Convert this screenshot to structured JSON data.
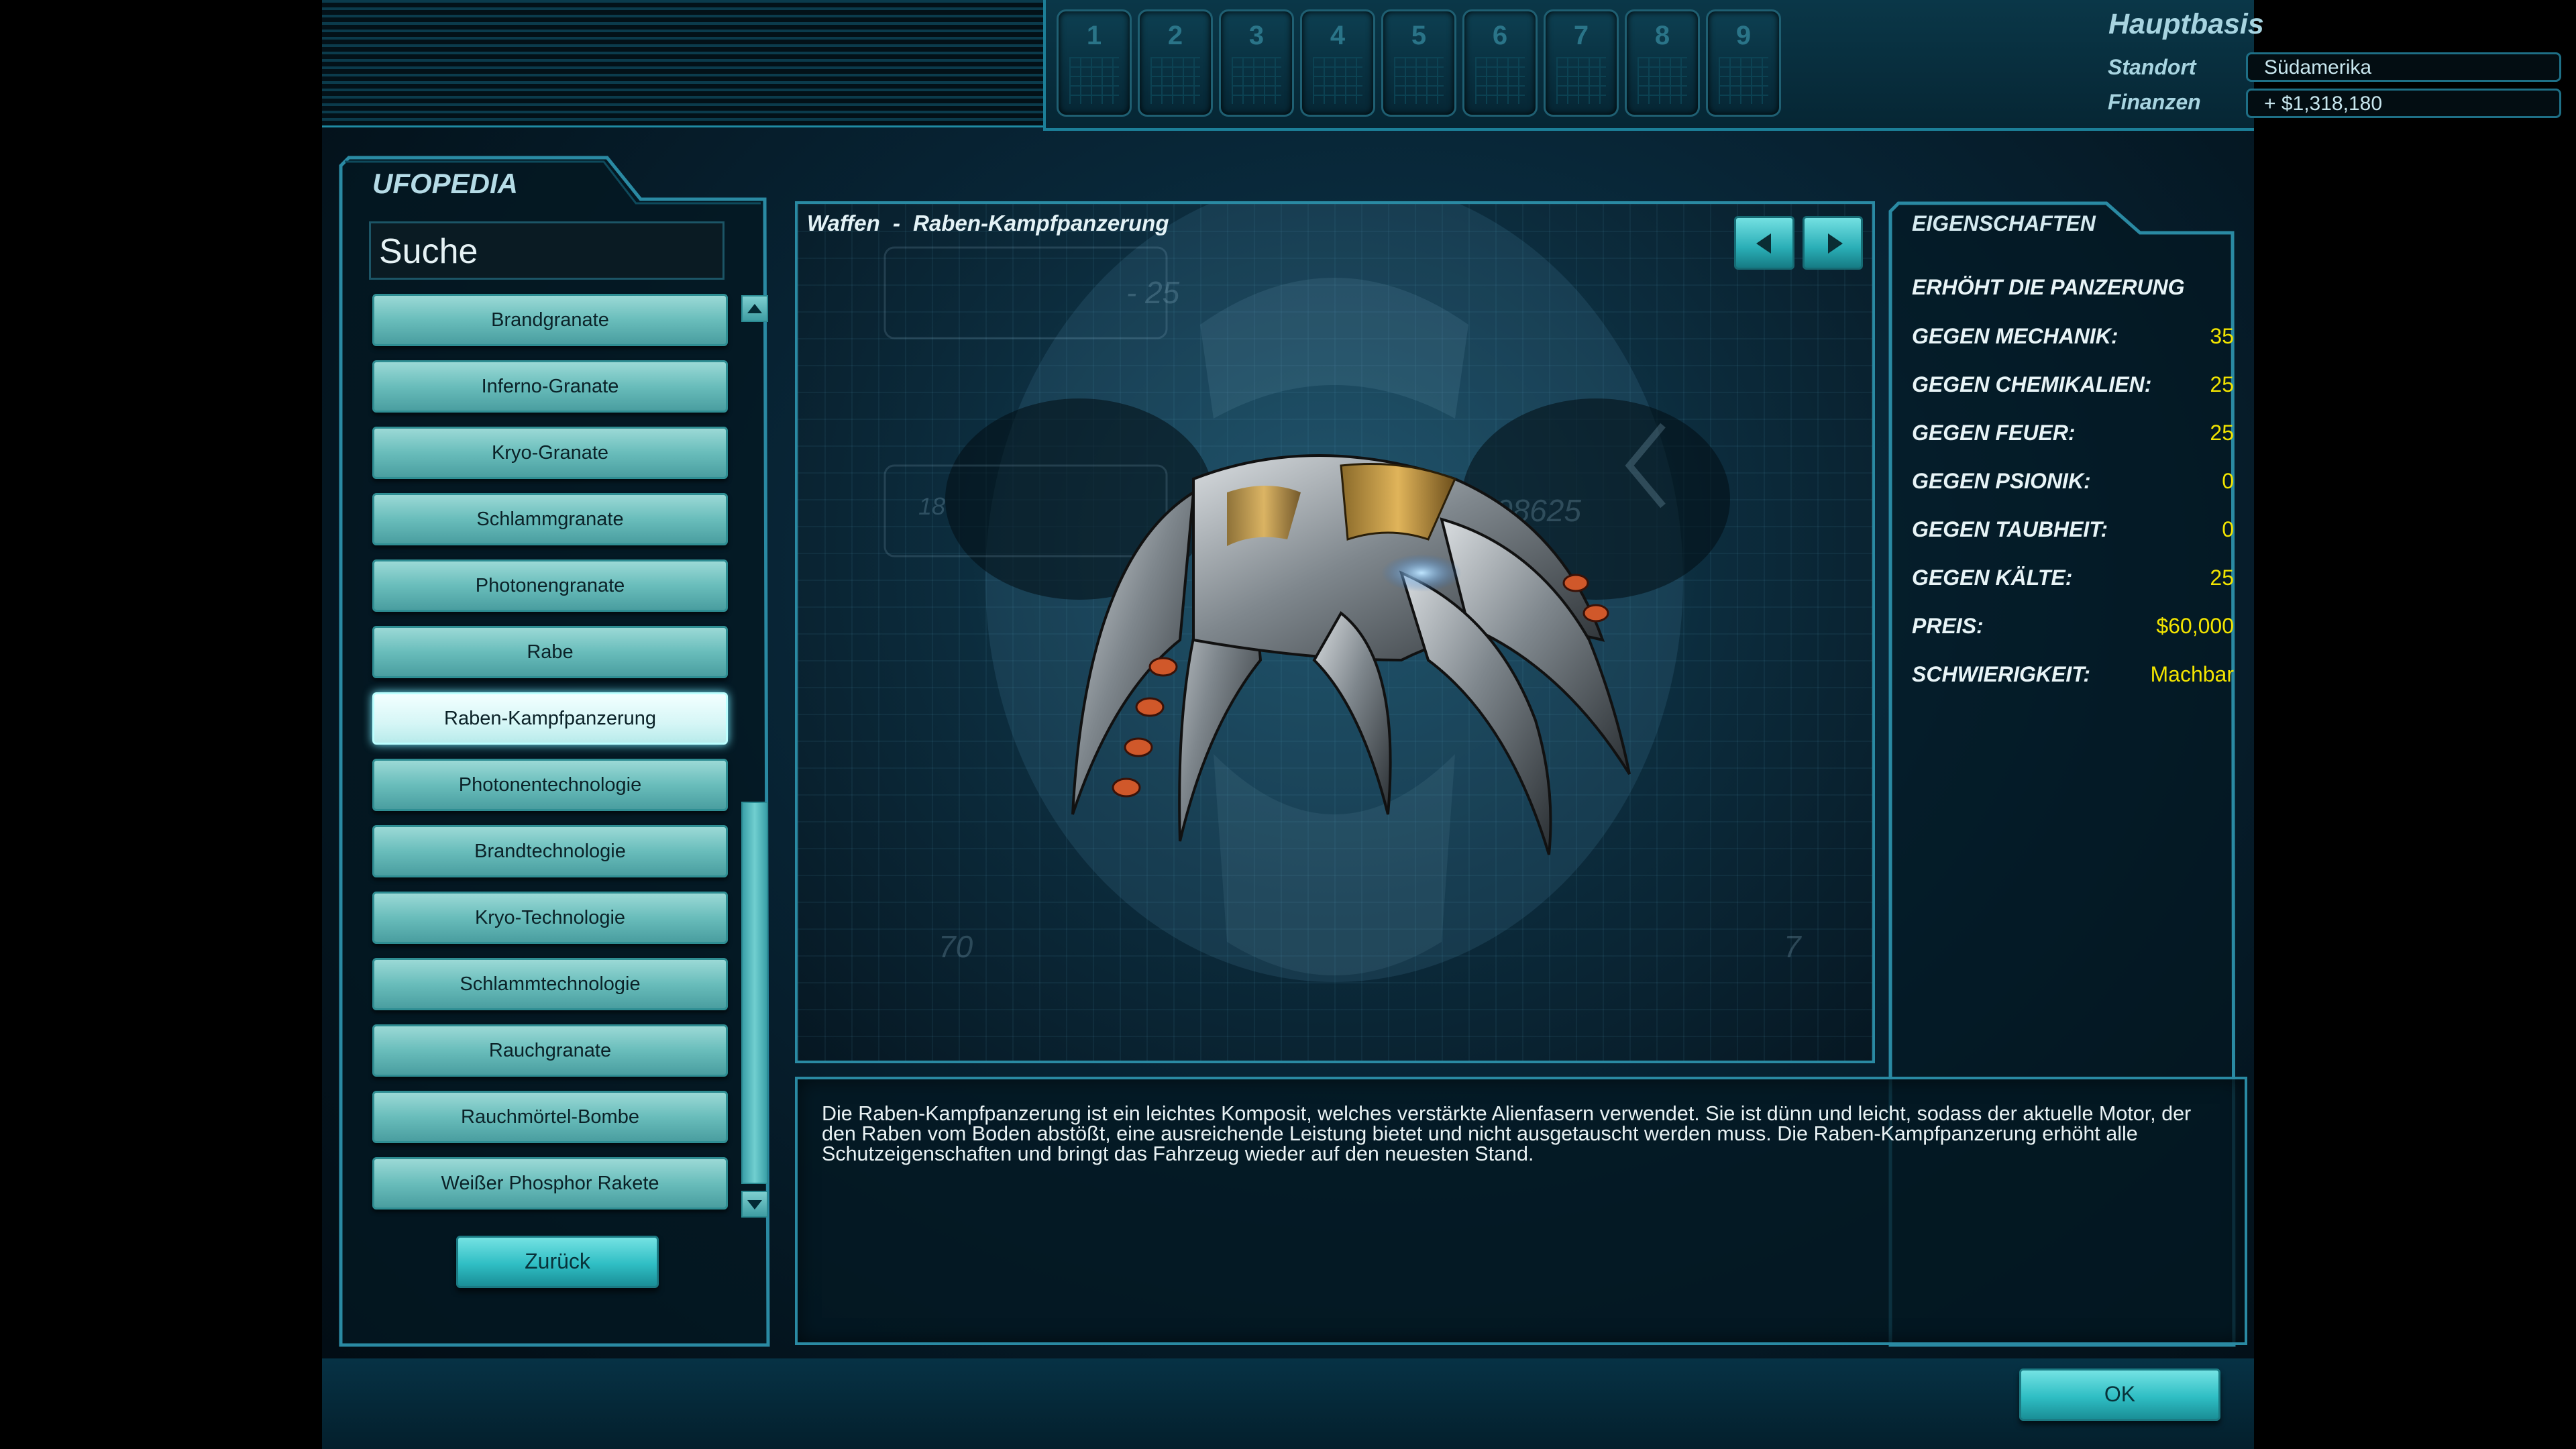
{
  "header": {
    "base_name": "Hauptbasis",
    "location_label": "Standort",
    "location_value": "Südamerika",
    "finances_label": "Finanzen",
    "finances_value": "+ $1,318,180",
    "slots": [
      "1",
      "2",
      "3",
      "4",
      "5",
      "6",
      "7",
      "8",
      "9"
    ]
  },
  "ufopedia": {
    "title": "UFOPEDIA",
    "search_label": "Suche",
    "items": [
      "Brandgranate",
      "Inferno-Granate",
      "Kryo-Granate",
      "Schlammgranate",
      "Photonengranate",
      "Rabe",
      "Raben-Kampfpanzerung",
      "Photonentechnologie",
      "Brandtechnologie",
      "Kryo-Technologie",
      "Schlammtechnologie",
      "Rauchgranate",
      "Rauchmörtel-Bombe",
      "Weißer Phosphor Rakete"
    ],
    "selected_item": "Raben-Kampfpanzerung",
    "back_label": "Zurück"
  },
  "viewer": {
    "category": "Waffen",
    "separator": "-",
    "name": "Raben-Kampfpanzerung"
  },
  "properties": {
    "title": "EIGENSCHAFTEN",
    "headline": "ERHÖHT DIE PANZERUNG",
    "rows": [
      {
        "label": "GEGEN MECHANIK:",
        "value": "35"
      },
      {
        "label": "GEGEN CHEMIKALIEN:",
        "value": "25"
      },
      {
        "label": "GEGEN FEUER:",
        "value": "25"
      },
      {
        "label": "GEGEN PSIONIK:",
        "value": "0"
      },
      {
        "label": "GEGEN TAUBHEIT:",
        "value": "0"
      },
      {
        "label": "GEGEN KÄLTE:",
        "value": "25"
      },
      {
        "label": "PREIS:",
        "value": "$60,000"
      },
      {
        "label": "SCHWIERIGKEIT:",
        "value": "Machbar"
      }
    ]
  },
  "description": "Die Raben-Kampfpanzerung ist ein leichtes Komposit, welches verstärkte Alienfasern verwendet. Sie ist dünn und leicht, sodass der aktuelle Motor, der den Raben vom Boden abstößt, eine ausreichende Leistung bietet und nicht ausgetauscht werden muss. Die Raben-Kampfpanzerung erhöht alle Schutzeigenschaften und bringt das Fahrzeug wieder auf den neuesten Stand.",
  "ok_label": "OK",
  "colors": {
    "accent": "#2a8aa3",
    "value_yellow": "#f2e400",
    "button_cyan": "#2fbec4"
  }
}
